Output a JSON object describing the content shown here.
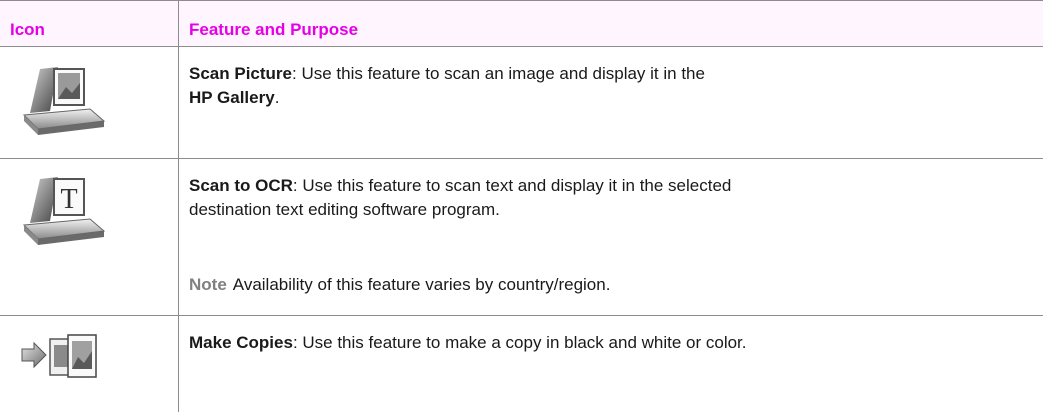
{
  "header": {
    "icon_col": "Icon",
    "feature_col": "Feature and Purpose"
  },
  "rows": [
    {
      "icon": "scan-picture-icon",
      "title": "Scan Picture",
      "text": ": Use this feature to scan an image and display it in the",
      "text2_bold": "HP Gallery",
      "text2_end": "."
    },
    {
      "icon": "scan-to-ocr-icon",
      "title": "Scan to OCR",
      "text": ": Use this feature to scan text and display it in the selected",
      "text2": "destination text editing software program.",
      "note_label": "Note",
      "note_text": "Availability of this feature varies by country/region."
    },
    {
      "icon": "make-copies-icon",
      "title": "Make Copies",
      "text": ": Use this feature to make a copy in black and white or color."
    }
  ],
  "colors": {
    "header_text": "#e600e6",
    "header_bg": "#fff5ff",
    "rule": "#8c8c8c",
    "note_label": "#808080"
  }
}
